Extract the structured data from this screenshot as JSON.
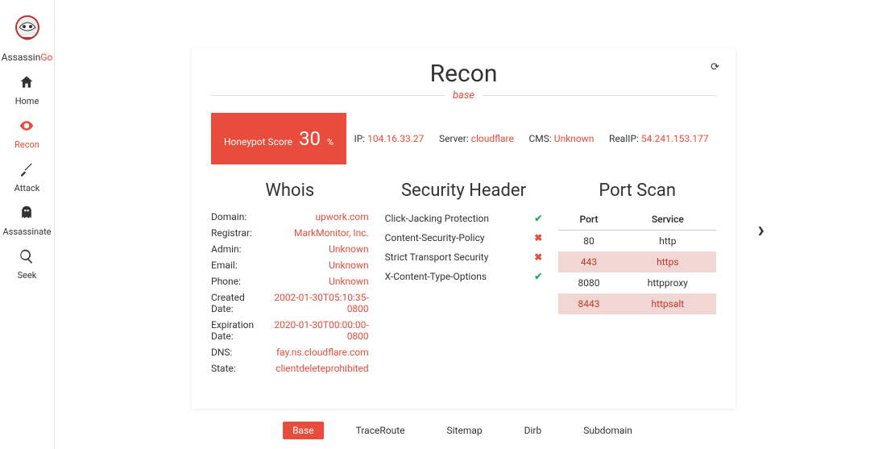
{
  "brand": {
    "name": "Assassin",
    "suffix": "Go"
  },
  "nav": [
    {
      "id": "home",
      "label": "Home",
      "icon": "home"
    },
    {
      "id": "recon",
      "label": "Recon",
      "icon": "eye",
      "active": true
    },
    {
      "id": "attack",
      "label": "Attack",
      "icon": "knife"
    },
    {
      "id": "assassinate",
      "label": "Assassinate",
      "icon": "ghost"
    },
    {
      "id": "seek",
      "label": "Seek",
      "icon": "search"
    }
  ],
  "card": {
    "title": "Recon",
    "subtitle": "base",
    "honeypot": {
      "label": "Honeypot Score",
      "value": "30",
      "unit": "%"
    },
    "info": {
      "ip": {
        "label": "IP: ",
        "value": "104.16.33.27"
      },
      "server": {
        "label": "Server: ",
        "value": "cloudflare"
      },
      "cms": {
        "label": "CMS: ",
        "value": "Unknown"
      },
      "realip": {
        "label": "RealIP: ",
        "value": "54.241.153.177"
      }
    },
    "whois": {
      "title": "Whois",
      "rows": [
        {
          "k": "Domain:",
          "v": "upwork.com"
        },
        {
          "k": "Registrar:",
          "v": "MarkMonitor, Inc."
        },
        {
          "k": "Admin:",
          "v": "Unknown"
        },
        {
          "k": "Email:",
          "v": "Unknown"
        },
        {
          "k": "Phone:",
          "v": "Unknown"
        },
        {
          "k": "Created Date:",
          "v": "2002-01-30T05:10:35-0800"
        },
        {
          "k": "Expiration Date:",
          "v": "2020-01-30T00:00:00-0800"
        },
        {
          "k": "DNS:",
          "v": "fay.ns.cloudflare.com"
        },
        {
          "k": "State:",
          "v": "clientdeleteprohibited"
        }
      ]
    },
    "security": {
      "title": "Security Header",
      "rows": [
        {
          "name": "Click-Jacking Protection",
          "ok": true
        },
        {
          "name": "Content-Security-Policy",
          "ok": false
        },
        {
          "name": "Strict Transport Security",
          "ok": false
        },
        {
          "name": "X-Content-Type-Options",
          "ok": true
        }
      ]
    },
    "portscan": {
      "title": "Port Scan",
      "headers": {
        "port": "Port",
        "service": "Service"
      },
      "rows": [
        {
          "port": "80",
          "service": "http",
          "hl": false
        },
        {
          "port": "443",
          "service": "https",
          "hl": true
        },
        {
          "port": "8080",
          "service": "httpproxy",
          "hl": false
        },
        {
          "port": "8443",
          "service": "httpsalt",
          "hl": true
        }
      ]
    }
  },
  "tabs": [
    {
      "label": "Base",
      "active": true
    },
    {
      "label": "TraceRoute"
    },
    {
      "label": "Sitemap"
    },
    {
      "label": "Dirb"
    },
    {
      "label": "Subdomain"
    }
  ]
}
